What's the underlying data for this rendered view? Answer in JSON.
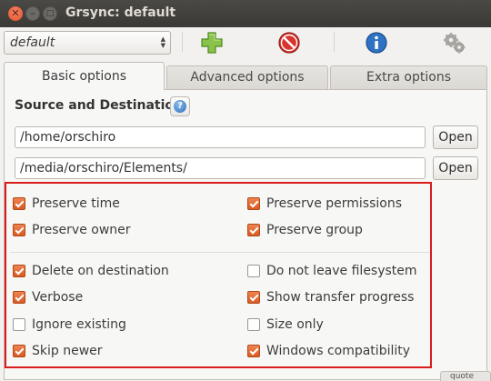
{
  "window": {
    "title": "Grsync: default"
  },
  "toolbar": {
    "profile_value": "default",
    "buttons": [
      {
        "icon": "plus-icon"
      },
      {
        "icon": "stop-icon"
      },
      {
        "icon": "info-icon"
      },
      {
        "icon": "gears-icon"
      }
    ]
  },
  "tabs": [
    {
      "label": "Basic options",
      "active": true
    },
    {
      "label": "Advanced options",
      "active": false
    },
    {
      "label": "Extra options",
      "active": false
    }
  ],
  "source_dest": {
    "heading": "Source and Destination:",
    "help_icon": "question-icon",
    "source": "/home/orschiro",
    "destination": "/media/orschiro/Elements/",
    "open_label": "Open"
  },
  "options": [
    {
      "label": "Preserve time",
      "checked": true
    },
    {
      "label": "Preserve permissions",
      "checked": true
    },
    {
      "label": "Preserve owner",
      "checked": true
    },
    {
      "label": "Preserve group",
      "checked": true
    },
    {
      "label": "Delete on destination",
      "checked": true
    },
    {
      "label": "Do not leave filesystem",
      "checked": false
    },
    {
      "label": "Verbose",
      "checked": true
    },
    {
      "label": "Show transfer progress",
      "checked": true
    },
    {
      "label": "Ignore existing",
      "checked": false
    },
    {
      "label": "Size only",
      "checked": false
    },
    {
      "label": "Skip newer",
      "checked": true
    },
    {
      "label": "Windows compatibility",
      "checked": true
    }
  ],
  "bottom_fragment": "quote",
  "colors": {
    "check_on": "#e3692f",
    "highlight": "#d91c1c",
    "titlebar": "#3c3b37"
  }
}
